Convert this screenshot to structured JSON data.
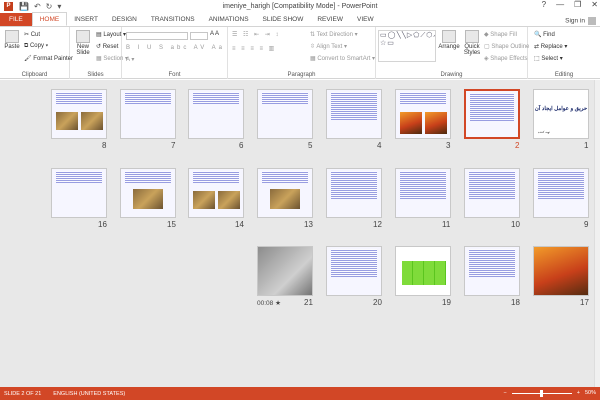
{
  "window": {
    "title": "imeniye_harigh [Compatibility Mode] - PowerPoint",
    "app_icon": "powerpoint-icon",
    "help": "?",
    "minimize": "—",
    "restore": "❐",
    "close": "✕"
  },
  "qat": {
    "save": "💾",
    "undo": "↶",
    "redo": "↻",
    "customize": "▾"
  },
  "tabs": {
    "file": "FILE",
    "home": "HOME",
    "insert": "INSERT",
    "design": "DESIGN",
    "transitions": "TRANSITIONS",
    "animations": "ANIMATIONS",
    "slideshow": "SLIDE SHOW",
    "review": "REVIEW",
    "view": "VIEW",
    "signin": "Sign in"
  },
  "ribbon": {
    "clipboard": {
      "label": "Clipboard",
      "paste": "Paste",
      "cut": "Cut",
      "copy": "Copy",
      "format_painter": "Format Painter"
    },
    "slides": {
      "label": "Slides",
      "new_slide": "New Slide",
      "layout": "Layout",
      "reset": "Reset",
      "section": "Section"
    },
    "font": {
      "label": "Font"
    },
    "paragraph": {
      "label": "Paragraph",
      "text_direction": "Text Direction",
      "align_text": "Align Text",
      "convert_smartart": "Convert to SmartArt"
    },
    "drawing": {
      "label": "Drawing",
      "shapes": "▭◯╲╲▷⬠⟋⬡⌒{}☆▭",
      "arrange": "Arrange",
      "quick_styles": "Quick Styles",
      "shape_fill": "Shape Fill",
      "shape_outline": "Shape Outline",
      "shape_effects": "Shape Effects"
    },
    "editing": {
      "label": "Editing",
      "find": "Find",
      "replace": "Replace",
      "select": "Select"
    }
  },
  "slides": [
    {
      "num": "1",
      "kind": "title",
      "big": "حريق و عوامل ايجاد آن",
      "small": "تهيه كننده"
    },
    {
      "num": "2",
      "kind": "text",
      "selected": true
    },
    {
      "num": "3",
      "kind": "fire-pair"
    },
    {
      "num": "4",
      "kind": "text"
    },
    {
      "num": "5",
      "kind": "sparse"
    },
    {
      "num": "6",
      "kind": "sparse"
    },
    {
      "num": "7",
      "kind": "sparse"
    },
    {
      "num": "8",
      "kind": "photo-pair"
    },
    {
      "num": "9",
      "kind": "text"
    },
    {
      "num": "10",
      "kind": "text"
    },
    {
      "num": "11",
      "kind": "text"
    },
    {
      "num": "12",
      "kind": "text"
    },
    {
      "num": "13",
      "kind": "photo-single"
    },
    {
      "num": "14",
      "kind": "photo-pair"
    },
    {
      "num": "15",
      "kind": "photo-single"
    },
    {
      "num": "16",
      "kind": "sparse"
    },
    {
      "num": "17",
      "kind": "fire-full"
    },
    {
      "num": "18",
      "kind": "text"
    },
    {
      "num": "19",
      "kind": "green-table"
    },
    {
      "num": "20",
      "kind": "text"
    },
    {
      "num": "21",
      "kind": "laptop",
      "timing": "00:08",
      "timing_icon": "★"
    }
  ],
  "status": {
    "slide_of": "SLIDE 2 OF 21",
    "language": "ENGLISH (UNITED STATES)",
    "zoom": "50%",
    "zoom_minus": "−",
    "zoom_plus": "+"
  }
}
